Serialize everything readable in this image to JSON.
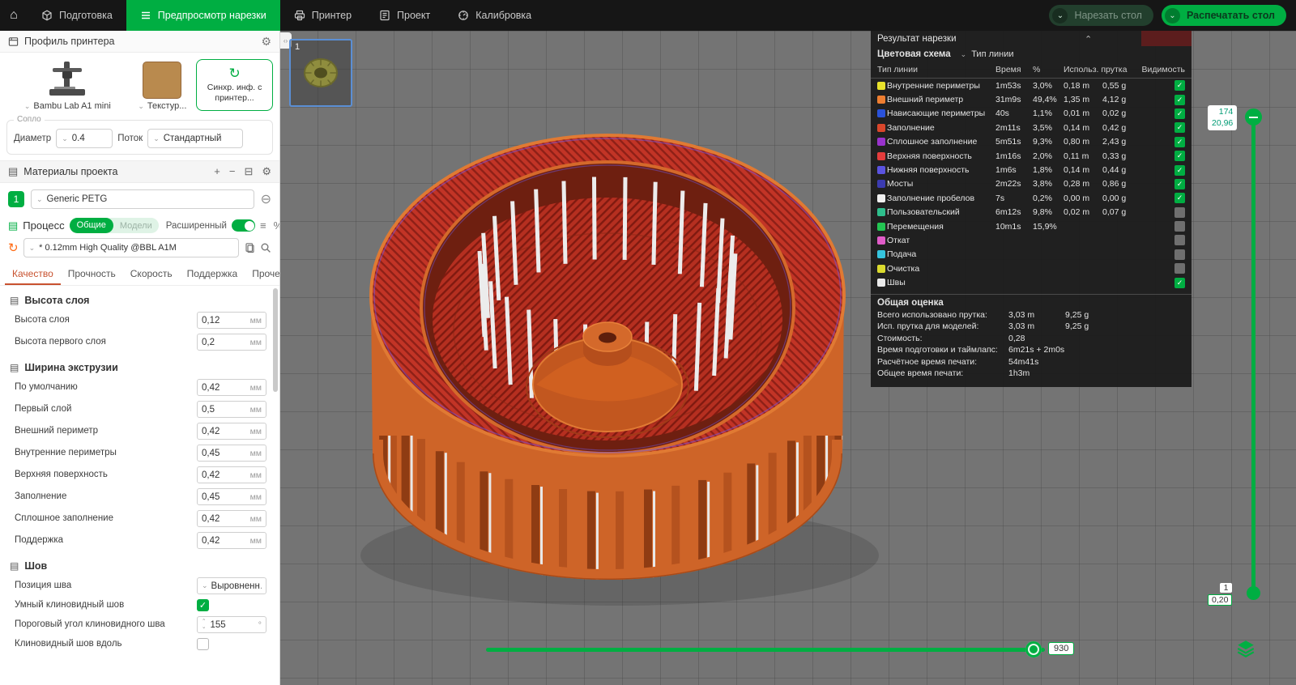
{
  "icons": {
    "home": "⌂",
    "gear": "⚙",
    "plus": "+",
    "minus": "−",
    "grid": "⊟",
    "refresh": "↻",
    "list": "≡",
    "tune": "%",
    "caret_down": "⌄",
    "caret_up": "⌃",
    "check": "✓",
    "minus_circle": "⊖",
    "section": "▤",
    "panel_toggle": "‹›",
    "collapse": "⌃"
  },
  "topbar": {
    "tabs": [
      {
        "label": "Подготовка",
        "active": false
      },
      {
        "label": "Предпросмотр нарезки",
        "active": true
      },
      {
        "label": "Принтер",
        "active": false
      },
      {
        "label": "Проект",
        "active": false
      },
      {
        "label": "Калибровка",
        "active": false
      }
    ],
    "slice_button_label": "Нарезать стол",
    "print_button_label": "Распечатать стол"
  },
  "sidebar": {
    "profile": {
      "title": "Профиль принтера",
      "printer_name": "Bambu Lab A1 mini",
      "plate_type": "Текстур...",
      "sync_label": "Синхр. инф. с принтер...",
      "nozzle_group": "Сопло",
      "diameter_label": "Диаметр",
      "diameter_value": "0.4",
      "flow_label": "Поток",
      "flow_value": "Стандартный"
    },
    "materials": {
      "title": "Материалы проекта",
      "filament_index": "1",
      "filament_name": "Generic PETG"
    },
    "process": {
      "title": "Процесс",
      "scope_global": "Общие",
      "scope_objects": "Модели",
      "advanced_label": "Расширенный",
      "preset_name": "* 0.12mm High Quality @BBL A1M",
      "tabs": [
        "Качество",
        "Прочность",
        "Скорость",
        "Поддержка",
        "Прочее"
      ],
      "active_tab": "Качество"
    },
    "param_sections": [
      {
        "title": "Высота слоя",
        "rows": [
          {
            "label": "Высота слоя",
            "type": "input",
            "value": "0,12",
            "unit": "мм"
          },
          {
            "label": "Высота первого слоя",
            "type": "input",
            "value": "0,2",
            "unit": "мм"
          }
        ]
      },
      {
        "title": "Ширина экструзии",
        "rows": [
          {
            "label": "По умолчанию",
            "type": "input",
            "value": "0,42",
            "unit": "мм"
          },
          {
            "label": "Первый слой",
            "type": "input",
            "value": "0,5",
            "unit": "мм"
          },
          {
            "label": "Внешний периметр",
            "type": "input",
            "value": "0,42",
            "unit": "мм"
          },
          {
            "label": "Внутренние периметры",
            "type": "input",
            "value": "0,45",
            "unit": "мм"
          },
          {
            "label": "Верхняя поверхность",
            "type": "input",
            "value": "0,42",
            "unit": "мм"
          },
          {
            "label": "Заполнение",
            "type": "input",
            "value": "0,45",
            "unit": "мм"
          },
          {
            "label": "Сплошное заполнение",
            "type": "input",
            "value": "0,42",
            "unit": "мм"
          },
          {
            "label": "Поддержка",
            "type": "input",
            "value": "0,42",
            "unit": "мм"
          }
        ]
      },
      {
        "title": "Шов",
        "rows": [
          {
            "label": "Позиция шва",
            "type": "select",
            "value": "Выровненн…"
          },
          {
            "label": "Умный клиновидный шов",
            "type": "checkbox",
            "checked": true
          },
          {
            "label": "Пороговый угол клиновидного шва",
            "type": "spinner",
            "value": "155",
            "unit": "°"
          },
          {
            "label": "Клиновидный шов вдоль",
            "type": "checkbox",
            "checked": false
          }
        ]
      }
    ]
  },
  "viewport": {
    "plate_number": "1",
    "layer_slider": {
      "top_layer": "174",
      "top_height": "20,96",
      "bottom_layer": "1",
      "bottom_height": "0,20"
    },
    "move_slider_value": "930"
  },
  "slice_result": {
    "title": "Результат нарезки",
    "color_scheme_label": "Цветовая схема",
    "color_scheme_value": "Тип линии",
    "columns": {
      "type": "Тип линии",
      "time": "Время",
      "pct": "%",
      "filament": "Использ. прутка",
      "visibility": "Видимость"
    },
    "rows": [
      {
        "color": "#E8E22C",
        "name": "Внутренние периметры",
        "time": "1m53s",
        "pct": "3,0%",
        "len": "0,18 m",
        "wt": "0,55 g",
        "visible": true
      },
      {
        "color": "#EE7E31",
        "name": "Внешний периметр",
        "time": "31m9s",
        "pct": "49,4%",
        "len": "1,35 m",
        "wt": "4,12 g",
        "visible": true
      },
      {
        "color": "#2A52DA",
        "name": "Нависающие периметры",
        "time": "40s",
        "pct": "1,1%",
        "len": "0,01 m",
        "wt": "0,02 g",
        "visible": true
      },
      {
        "color": "#D9462B",
        "name": "Заполнение",
        "time": "2m11s",
        "pct": "3,5%",
        "len": "0,14 m",
        "wt": "0,42 g",
        "visible": true
      },
      {
        "color": "#9932CC",
        "name": "Сплошное заполнение",
        "time": "5m51s",
        "pct": "9,3%",
        "len": "0,80 m",
        "wt": "2,43 g",
        "visible": true
      },
      {
        "color": "#E43C3C",
        "name": "Верхняя поверхность",
        "time": "1m16s",
        "pct": "2,0%",
        "len": "0,11 m",
        "wt": "0,33 g",
        "visible": true
      },
      {
        "color": "#5A53E0",
        "name": "Нижняя поверхность",
        "time": "1m6s",
        "pct": "1,8%",
        "len": "0,14 m",
        "wt": "0,44 g",
        "visible": true
      },
      {
        "color": "#3B3BB0",
        "name": "Мосты",
        "time": "2m22s",
        "pct": "3,8%",
        "len": "0,28 m",
        "wt": "0,86 g",
        "visible": true
      },
      {
        "color": "#F0F0F0",
        "name": "Заполнение пробелов",
        "time": "7s",
        "pct": "0,2%",
        "len": "0,00 m",
        "wt": "0,00 g",
        "visible": true
      },
      {
        "color": "#2EBE8C",
        "name": "Пользовательский",
        "time": "6m12s",
        "pct": "9,8%",
        "len": "0,02 m",
        "wt": "0,07 g",
        "visible": false
      },
      {
        "color": "#23C552",
        "name": "Перемещения",
        "time": "10m1s",
        "pct": "15,9%",
        "len": "",
        "wt": "",
        "visible": false
      },
      {
        "color": "#E05CC8",
        "name": "Откат",
        "time": "",
        "pct": "",
        "len": "",
        "wt": "",
        "visible": false
      },
      {
        "color": "#35C4DE",
        "name": "Подача",
        "time": "",
        "pct": "",
        "len": "",
        "wt": "",
        "visible": false
      },
      {
        "color": "#DADA2E",
        "name": "Очистка",
        "time": "",
        "pct": "",
        "len": "",
        "wt": "",
        "visible": false
      },
      {
        "color": "#EAEAEA",
        "name": "Швы",
        "time": "",
        "pct": "",
        "len": "",
        "wt": "",
        "visible": true
      }
    ],
    "summary_title": "Общая оценка",
    "summary_rows": [
      {
        "label": "Всего использовано прутка:",
        "value1": "3,03 m",
        "value2": "9,25 g"
      },
      {
        "label": "Исп. прутка для моделей:",
        "value1": "3,03 m",
        "value2": "9,25 g"
      },
      {
        "label": "Стоимость:",
        "value1": "0,28",
        "value2": ""
      },
      {
        "label": "Время подготовки и таймлапс:",
        "value1": "6m21s + 2m0s",
        "value2": ""
      },
      {
        "label": "Расчётное время печати:",
        "value1": "54m41s",
        "value2": ""
      },
      {
        "label": "Общее время печати:",
        "value1": "1h3m",
        "value2": ""
      }
    ]
  }
}
